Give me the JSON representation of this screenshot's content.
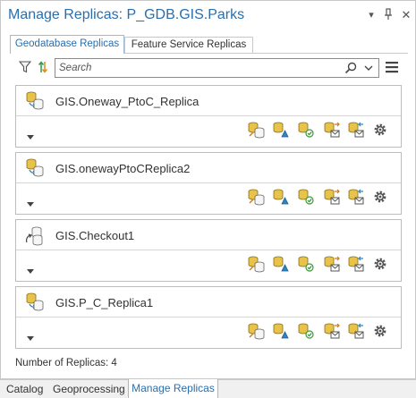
{
  "window": {
    "title": "Manage Replicas: P_GDB.GIS.Parks",
    "options_glyph": "▾",
    "pin_glyph": "⊥",
    "close_glyph": "✕"
  },
  "tabs": [
    {
      "label": "Geodatabase Replicas",
      "active": true
    },
    {
      "label": "Feature Service Replicas",
      "active": false
    }
  ],
  "toolbar": {
    "filter_icon": "filter-icon",
    "sort_icon": "sort-icon",
    "search_placeholder": "Search",
    "menu_icon": "hamburger-menu-icon"
  },
  "replicas": [
    {
      "name": "GIS.Oneway_PtoC_Replica",
      "type_icon": "oneway-replica-icon"
    },
    {
      "name": "GIS.onewayPtoCReplica2",
      "type_icon": "oneway-replica-icon"
    },
    {
      "name": "GIS.Checkout1",
      "type_icon": "checkout-replica-icon"
    },
    {
      "name": "GIS.P_C_Replica1",
      "type_icon": "oneway-replica-icon"
    }
  ],
  "actions": [
    "synchronize",
    "validate",
    "unregister",
    "export-message",
    "import-message",
    "properties"
  ],
  "status": {
    "count_text": "Number of Replicas: 4"
  },
  "bottom_tabs": [
    {
      "label": "Catalog",
      "active": false
    },
    {
      "label": "Geoprocessing",
      "active": false
    },
    {
      "label": "Manage Replicas",
      "active": true
    }
  ],
  "colors": {
    "accent": "#2a6ead",
    "db_yellow": "#e7c34a",
    "db_blue": "#2e86c1",
    "check_green": "#3a9a3a"
  }
}
